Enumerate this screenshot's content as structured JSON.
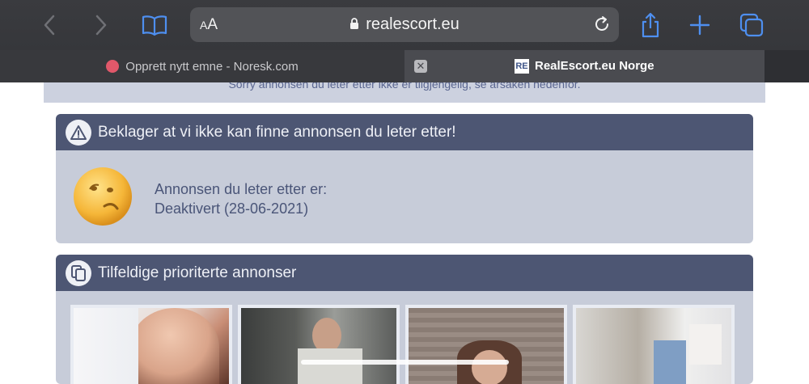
{
  "browser": {
    "address_text_size": "AA",
    "url": "realescort.eu",
    "icons": [
      "back-icon",
      "forward-icon",
      "bookmarks-book-icon",
      "lock-icon",
      "reload-icon",
      "share-icon",
      "new-tab-plus-icon",
      "tabs-overview-icon"
    ]
  },
  "tabs": [
    {
      "label": "Opprett nytt emne - Noresk.com",
      "active": false
    },
    {
      "label": "RealEscort.eu Norge",
      "active": true,
      "favicon_text": "RE"
    }
  ],
  "page": {
    "notice": "Sorry annonsen du leter etter ikke er tilgjengelig, se årsaken nedenfor.",
    "not_found_panel": {
      "title": "Beklager at vi ikke kan finne annonsen du leter etter!",
      "icon": "warning-triangle-icon",
      "message_line1": "Annonsen du leter etter er:",
      "message_line2": "Deaktivert (28-06-2021)"
    },
    "priority_panel": {
      "title": "Tilfeldige prioriterte annonser",
      "icon": "copy-documents-icon",
      "thumbnail_count": 4
    }
  },
  "colors": {
    "panel_header": "#4d5673",
    "panel_body": "#c7ccd9",
    "text_blue": "#4a5578"
  }
}
